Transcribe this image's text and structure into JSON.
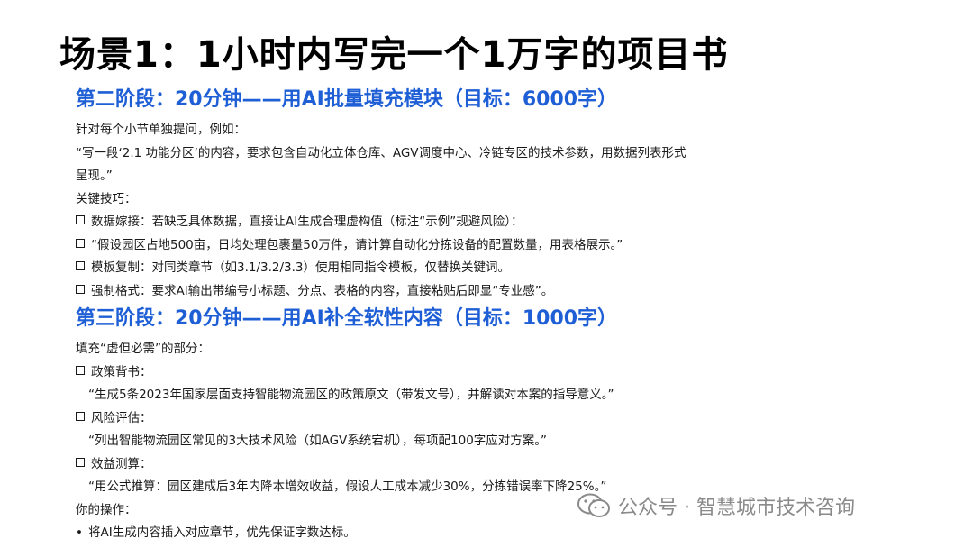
{
  "title": "场景1：1小时内写完一个1万字的项目书",
  "stage2": {
    "heading": "第二阶段：20分钟——用AI批量填充模块（目标：6000字）",
    "intro": "针对每个小节单独提问，例如：",
    "quote_line1": "“写一段‘2.1 功能分区’的内容，要求包含自动化立体仓库、AGV调度中心、冷链专区的技术参数，用数据列表形式",
    "quote_line2": "呈现。”",
    "tips_label": "关键技巧：",
    "tips": [
      "数据嫁接：若缺乏具体数据，直接让AI生成合理虚构值（标注“示例”规避风险）：",
      "“假设园区占地500亩，日均处理包裹量50万件，请计算自动化分拣设备的配置数量，用表格展示。”",
      "模板复制：对同类章节（如3.1/3.2/3.3）使用相同指令模板，仅替换关键词。",
      "强制格式：要求AI输出带编号小标题、分点、表格的内容，直接粘贴后即显“专业感”。"
    ]
  },
  "stage3": {
    "heading": "第三阶段：20分钟——用AI补全软性内容（目标：1000字）",
    "intro": "填充“虚但必需”的部分：",
    "items": [
      {
        "label": "政策背书：",
        "quote": "“生成5条2023年国家层面支持智能物流园区的政策原文（带发文号），并解读对本案的指导意义。”"
      },
      {
        "label": "风险评估：",
        "quote": "“列出智能物流园区常见的3大技术风险（如AGV系统宕机），每项配100字应对方案。”"
      },
      {
        "label": "效益测算：",
        "quote": "“用公式推算：园区建成后3年内降本增效收益，假设人工成本减少30%，分拣错误率下降25%。”"
      }
    ],
    "ops_label": "你的操作：",
    "ops": [
      "将AI生成内容插入对应章节，优先保证字数达标。"
    ]
  },
  "watermark": {
    "text": "公众号 · 智慧城市技术咨询",
    "icon": "wechat-icon"
  },
  "colors": {
    "heading": "#1f5fd6",
    "title": "#000000",
    "watermark": "#8a8a8a"
  }
}
